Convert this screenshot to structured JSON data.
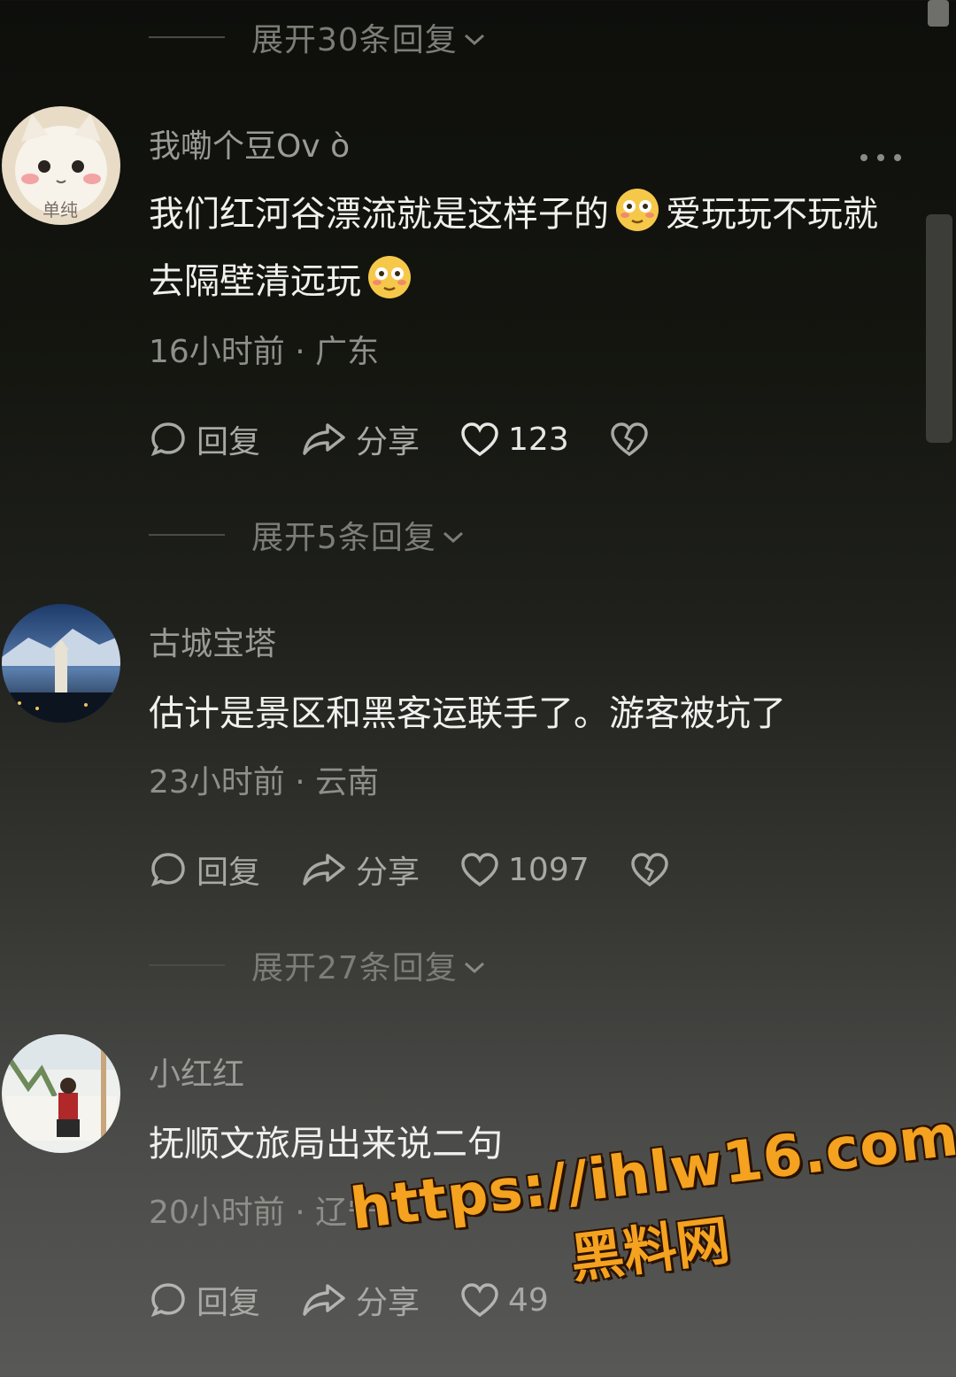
{
  "expand_replies": [
    {
      "label": "展开30条回复"
    },
    {
      "label": "展开5条回复"
    },
    {
      "label": "展开27条回复"
    }
  ],
  "comments": [
    {
      "username": "我嘞个豆Ov ò",
      "avatar_text": "单纯",
      "content_parts": [
        "我们红河谷漂流就是这样子的",
        "爱玩玩不玩就去隔壁清远玩"
      ],
      "emoji": "flushed-face-emoji",
      "time_location": "16小时前 · 广东",
      "reply_label": "回复",
      "share_label": "分享",
      "likes": "123"
    },
    {
      "username": "古城宝塔",
      "content": "估计是景区和黑客运联手了。游客被坑了",
      "time_location": "23小时前 · 云南",
      "reply_label": "回复",
      "share_label": "分享",
      "likes": "1097"
    },
    {
      "username": "小红红",
      "content": "抚顺文旅局出来说二句",
      "time_location": "20小时前 · 辽宁",
      "reply_label": "回复",
      "share_label": "分享",
      "likes": "49"
    }
  ],
  "watermark": {
    "url": "https://ihlw16.com",
    "name": "黑料网"
  },
  "colors": {
    "accent_watermark": "#f4a21f",
    "text_primary": "#f0f0ee",
    "text_secondary": "#8e8e8a"
  }
}
